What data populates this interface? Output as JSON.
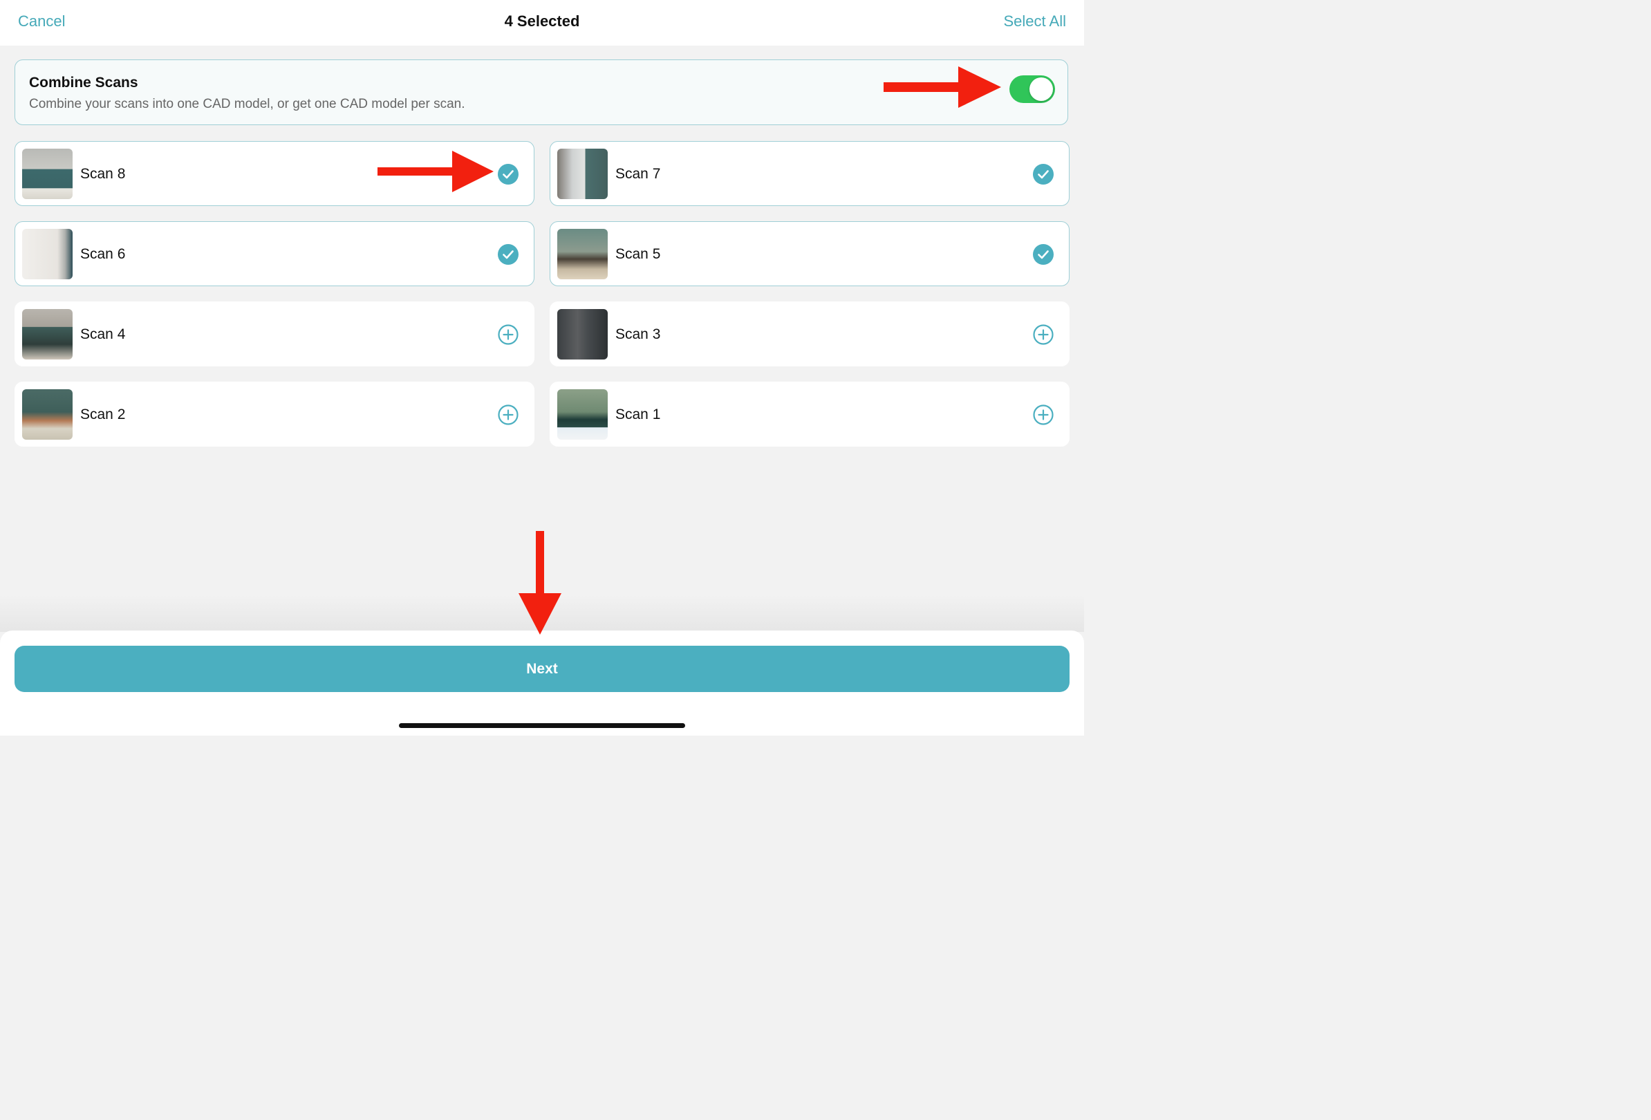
{
  "navbar": {
    "cancel_label": "Cancel",
    "title": "4 Selected",
    "select_all_label": "Select All"
  },
  "combine": {
    "title": "Combine Scans",
    "description": "Combine your scans into one CAD model, or get one CAD model per scan.",
    "enabled": true
  },
  "scans": [
    {
      "label": "Scan 8",
      "selected": true
    },
    {
      "label": "Scan 7",
      "selected": true
    },
    {
      "label": "Scan 6",
      "selected": true
    },
    {
      "label": "Scan 5",
      "selected": true
    },
    {
      "label": "Scan 4",
      "selected": false
    },
    {
      "label": "Scan 3",
      "selected": false
    },
    {
      "label": "Scan 2",
      "selected": false
    },
    {
      "label": "Scan 1",
      "selected": false
    }
  ],
  "next_label": "Next",
  "colors": {
    "accent": "#4bafc0",
    "toggle_on": "#30c559",
    "annotation_arrow": "#f2200f"
  }
}
